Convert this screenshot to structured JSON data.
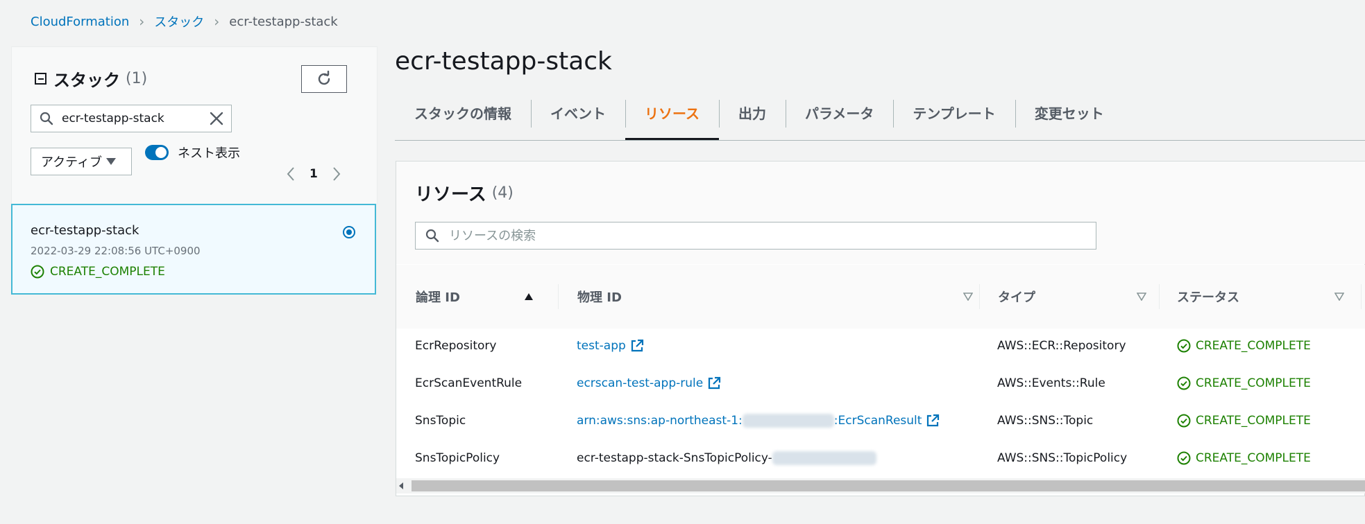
{
  "breadcrumb": {
    "items": [
      "CloudFormation",
      "スタック"
    ],
    "current": "ecr-testapp-stack"
  },
  "stacks_panel": {
    "title": "スタック",
    "count": "(1)",
    "search_value": "ecr-testapp-stack",
    "filter_select": "アクティブ",
    "nested_toggle_label": "ネスト表示",
    "nested_toggle_on": true,
    "page": "1",
    "selected_stack": {
      "name": "ecr-testapp-stack",
      "date": "2022-03-29 22:08:56 UTC+0900",
      "status": "CREATE_COMPLETE"
    }
  },
  "main": {
    "title": "ecr-testapp-stack",
    "tabs": [
      "スタックの情報",
      "イベント",
      "リソース",
      "出力",
      "パラメータ",
      "テンプレート",
      "変更セット"
    ],
    "active_tab": "リソース"
  },
  "resources": {
    "title": "リソース",
    "count": "(4)",
    "search_placeholder": "リソースの検索",
    "columns": [
      "論理 ID",
      "物理 ID",
      "タイプ",
      "ステータス"
    ],
    "rows": [
      {
        "logical_id": "EcrRepository",
        "physical_id": "test-app",
        "physical_suffix": "",
        "type": "AWS::ECR::Repository",
        "status": "CREATE_COMPLETE",
        "link": true
      },
      {
        "logical_id": "EcrScanEventRule",
        "physical_id": "ecrscan-test-app-rule",
        "physical_suffix": "",
        "type": "AWS::Events::Rule",
        "status": "CREATE_COMPLETE",
        "link": true
      },
      {
        "logical_id": "SnsTopic",
        "physical_id": "arn:aws:sns:ap-northeast-1:",
        "physical_suffix": ":EcrScanResult",
        "type": "AWS::SNS::Topic",
        "status": "CREATE_COMPLETE",
        "link": true
      },
      {
        "logical_id": "SnsTopicPolicy",
        "physical_id": "ecr-testapp-stack-SnsTopicPolicy-",
        "physical_suffix": "",
        "type": "AWS::SNS::TopicPolicy",
        "status": "CREATE_COMPLETE",
        "link": false
      }
    ]
  },
  "colors": {
    "link": "#0073bb",
    "success": "#1d8102",
    "active_tab": "#ec7211",
    "selected_border": "#44b9d6"
  }
}
